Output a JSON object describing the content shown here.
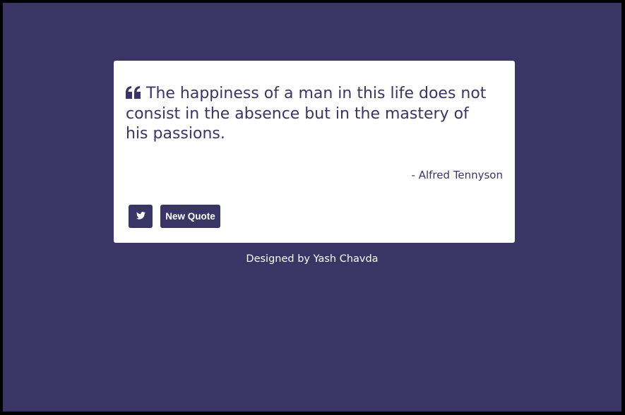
{
  "quote": {
    "icon": "quote-left-icon",
    "text": "The happiness of a man in this life does not consist in the absence but in the mastery of his passions.",
    "author": "- Alfred Tennyson"
  },
  "actions": {
    "tweet_icon": "twitter-icon",
    "new_quote_label": "New Quote"
  },
  "footer": {
    "credit": "Designed by Yash Chavda"
  },
  "colors": {
    "background": "#3b3566",
    "card": "#ffffff",
    "accent": "#3b3566",
    "border": "#000000"
  }
}
